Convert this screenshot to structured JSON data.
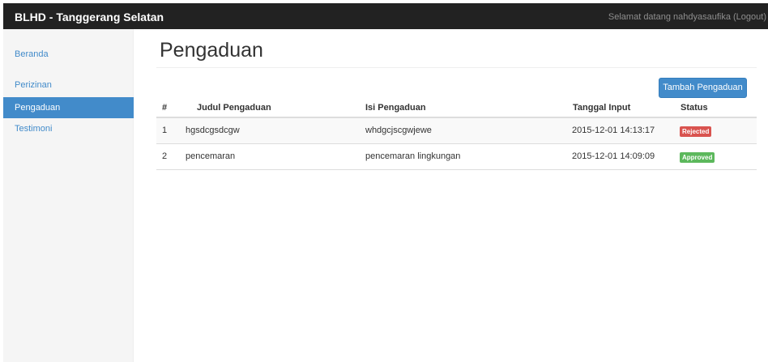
{
  "navbar": {
    "brand": "BLHD - Tanggerang Selatan",
    "welcome_prefix": "Selamat datang nahdyasaufika ",
    "logout_label": "(Logout)"
  },
  "sidebar": {
    "items": [
      {
        "label": "Beranda",
        "active": false
      },
      {
        "label": "Perizinan",
        "active": false
      },
      {
        "label": "Pengaduan",
        "active": true
      },
      {
        "label": "Testimoni",
        "active": false
      }
    ]
  },
  "main": {
    "title": "Pengaduan",
    "add_button_label": "Tambah Pengaduan",
    "table": {
      "headers": [
        "#",
        "Judul Pengaduan",
        "Isi Pengaduan",
        "Tanggal Input",
        "Status"
      ],
      "rows": [
        {
          "no": "1",
          "judul": "hgsdcgsdcgw",
          "isi": "whdgcjscgwjewe",
          "tanggal": "2015-12-01 14:13:17",
          "status": "Rejected",
          "status_color": "#d9534f"
        },
        {
          "no": "2",
          "judul": "pencemaran",
          "isi": "pencemaran lingkungan",
          "tanggal": "2015-12-01 14:09:09",
          "status": "Approved",
          "status_color": "#5cb85c"
        }
      ]
    }
  },
  "colors": {
    "navbar_bg": "#222222",
    "primary": "#428bca",
    "danger": "#d9534f",
    "success": "#5cb85c"
  }
}
